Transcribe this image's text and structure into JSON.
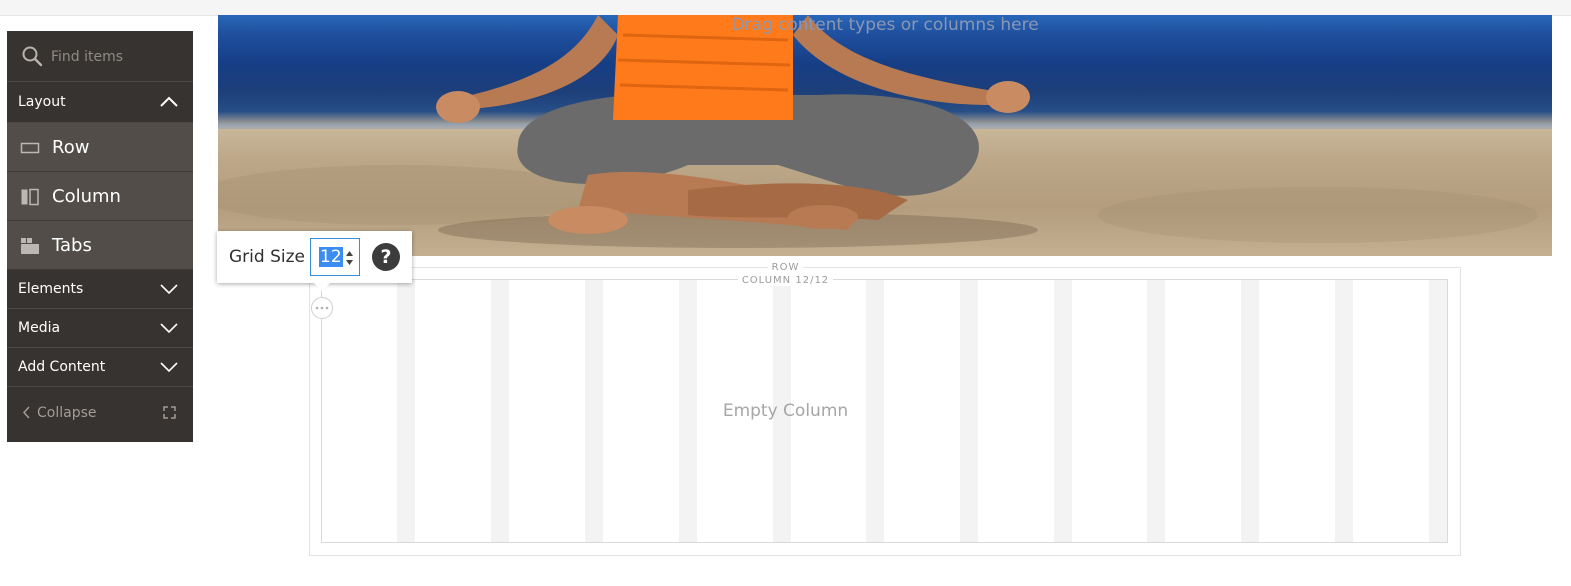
{
  "panel": {
    "search": {
      "placeholder": "Find items"
    },
    "layout_section": {
      "label": "Layout",
      "expanded": true
    },
    "layout_items": [
      {
        "label": "Row",
        "icon": "row-icon"
      },
      {
        "label": "Column",
        "icon": "column-icon"
      },
      {
        "label": "Tabs",
        "icon": "tabs-icon"
      }
    ],
    "sections": [
      {
        "label": "Elements",
        "expanded": false
      },
      {
        "label": "Media",
        "expanded": false
      },
      {
        "label": "Add Content",
        "expanded": false
      }
    ],
    "collapse_label": "Collapse"
  },
  "hero": {
    "drop_hint": "Drag content types or columns here"
  },
  "stage": {
    "row_label": "ROW",
    "column_label": "COLUMN 12/12",
    "empty_column_text": "Empty Column"
  },
  "grid_size": {
    "label": "Grid Size",
    "value": "12",
    "help_symbol": "?"
  },
  "colors": {
    "panel_bg": "#373330",
    "panel_item_bg": "#524d49",
    "selection_blue": "#3b8cf3"
  }
}
